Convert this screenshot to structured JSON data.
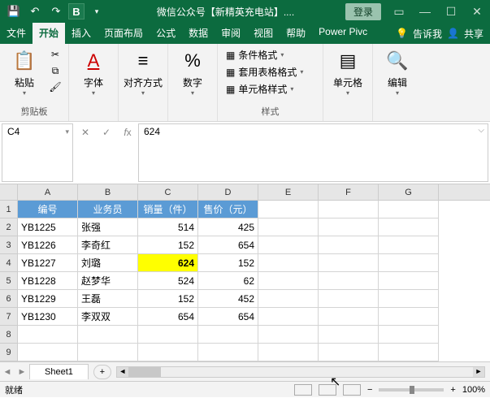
{
  "titlebar": {
    "document_name": "微信公众号【新精英充电站】....",
    "login": "登录",
    "bold_indicator": "B"
  },
  "tabs": {
    "file": "文件",
    "home": "开始",
    "insert": "插入",
    "page_layout": "页面布局",
    "formulas": "公式",
    "data": "数据",
    "review": "审阅",
    "view": "视图",
    "help": "帮助",
    "powerpivot": "Power Pivc",
    "tell_me": "告诉我",
    "share": "共享"
  },
  "ribbon": {
    "clipboard": {
      "paste": "粘贴",
      "group": "剪贴板"
    },
    "font": {
      "label": "字体",
      "A": "A"
    },
    "alignment": {
      "label": "对齐方式"
    },
    "number": {
      "label": "数字",
      "percent": "%"
    },
    "styles": {
      "cond": "条件格式",
      "table": "套用表格格式",
      "cell": "单元格样式",
      "group": "样式"
    },
    "cells": {
      "label": "单元格"
    },
    "editing": {
      "label": "编辑"
    }
  },
  "formula_bar": {
    "name_box": "C4",
    "value": "624"
  },
  "grid": {
    "col_labels": [
      "A",
      "B",
      "C",
      "D",
      "E",
      "F",
      "G"
    ],
    "row_labels": [
      "1",
      "2",
      "3",
      "4",
      "5",
      "6",
      "7",
      "8",
      "9"
    ],
    "headers": [
      "编号",
      "业务员",
      "销量（件）",
      "售价（元）"
    ],
    "data": [
      {
        "id": "YB1225",
        "name": "张强",
        "qty": "514",
        "price": "425"
      },
      {
        "id": "YB1226",
        "name": "李奇红",
        "qty": "152",
        "price": "654"
      },
      {
        "id": "YB1227",
        "name": "刘璐",
        "qty": "624",
        "price": "152"
      },
      {
        "id": "YB1228",
        "name": "赵梦华",
        "qty": "524",
        "price": "62"
      },
      {
        "id": "YB1229",
        "name": "王磊",
        "qty": "152",
        "price": "452"
      },
      {
        "id": "YB1230",
        "name": "李双双",
        "qty": "654",
        "price": "654"
      }
    ],
    "highlight_cell": {
      "row": 2,
      "col": "qty"
    }
  },
  "sheets": {
    "tab1": "Sheet1",
    "add": "+"
  },
  "statusbar": {
    "ready": "就绪",
    "zoom": "100%",
    "plus": "+"
  }
}
